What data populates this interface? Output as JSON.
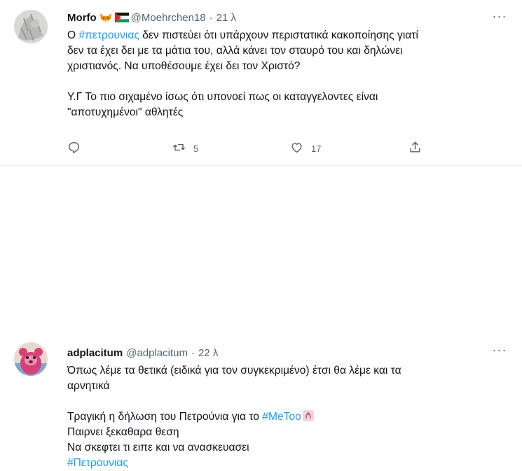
{
  "tweets": [
    {
      "name": "Morfo",
      "handle": "@Moehrchen18",
      "separator": "·",
      "time": "21 λ",
      "more": "···",
      "lines": [
        {
          "hashtag_prefix": "Ο ",
          "hashtag": "#πετρουνιας",
          "rest": " δεν πιστεύει ότι υπάρχουν περιστατικά κακοποίησης γιατί"
        },
        {
          "text": "δεν τα έχει δει με τα μάτια του, αλλά κάνει τον σταυρό του και δηλώνει"
        },
        {
          "text": "χριστιανός. Να υποθέσουμε έχει δει τον Χριστό?"
        },
        {
          "text": ""
        },
        {
          "text": "Υ.Γ Το πιο σιχαμένο ίσως ότι υπονοεί πως οι καταγγελοντες είναι"
        },
        {
          "text": "\"αποτυχημένοι\" αθλητές"
        }
      ],
      "actions": {
        "reply_count": "",
        "retweet_count": "5",
        "like_count": "17"
      }
    },
    {
      "name": "adplacitum",
      "handle": "@adplacitum",
      "separator": "·",
      "time": "22 λ",
      "more": "···",
      "lines": [
        {
          "text": "Όπως λέμε τα θετικά (ειδικά για τον συγκεκριμένο) έτσι θα λέμε και τα"
        },
        {
          "text": "αρνητικά"
        },
        {
          "text": ""
        },
        {
          "prefix": "Τραγική η δήλωση του Πετρούνια για το ",
          "hashtag": "#MeToo"
        },
        {
          "text": "Παιρνει ξεκαθαρα θεση"
        },
        {
          "text": "Να σκεφτει τι ειπε και να ανασκευασει"
        },
        {
          "hashtag_only": "#Πετρουνιας"
        }
      ]
    }
  ],
  "icons": {
    "reply": "reply-icon",
    "retweet": "retweet-icon",
    "like": "heart-icon",
    "share": "share-icon",
    "fox": "fox-emoji-icon",
    "flag": "palestine-flag-icon",
    "metoo": "metoo-badge-icon"
  },
  "colors": {
    "hashtag": "#1d9bf0",
    "secondary_text": "#536471",
    "primary_text": "#0f1419",
    "divider": "#eff3f4"
  }
}
